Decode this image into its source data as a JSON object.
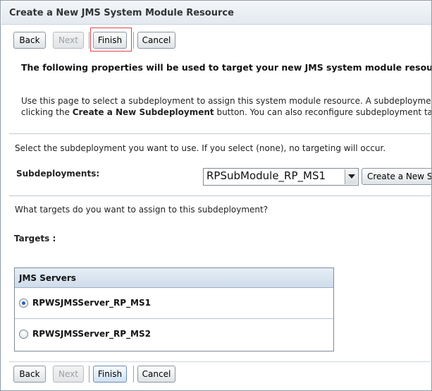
{
  "window": {
    "title": "Create a New JMS System Module Resource"
  },
  "toolbar_top": {
    "back": "Back",
    "next": "Next",
    "finish": "Finish",
    "cancel": "Cancel"
  },
  "content": {
    "heading": "The following properties will be used to target your new JMS system module resource",
    "intro_line1": "Use this page to select a subdeployment to assign this system module resource. A subdeployment is a mec",
    "intro_line2_prefix": "clicking the ",
    "intro_line2_bold": "Create a New Subdeployment",
    "intro_line2_suffix": " button. You can also reconfigure subdeployment targets lat",
    "select_prompt": "Select the subdeployment you want to use. If you select (none), no targeting will occur.",
    "subdeployments_label": "Subdeployments:",
    "subdeployment_selected": "RPSubModule_RP_MS1",
    "create_subdeployment_button": "Create a New Su",
    "targets_prompt": "What targets do you want to assign to this subdeployment?",
    "targets_label": "Targets :"
  },
  "targets_table": {
    "header": "JMS Servers",
    "rows": [
      {
        "label": "RPWSJMSServer_RP_MS1",
        "selected": true
      },
      {
        "label": "RPWSJMSServer_RP_MS2",
        "selected": false
      }
    ]
  },
  "toolbar_bottom": {
    "back": "Back",
    "next": "Next",
    "finish": "Finish",
    "cancel": "Cancel"
  },
  "colors": {
    "highlight_border": "#e0434b",
    "radio_checked": "#2a5fb4",
    "table_header_bg": "#cfdceb"
  }
}
